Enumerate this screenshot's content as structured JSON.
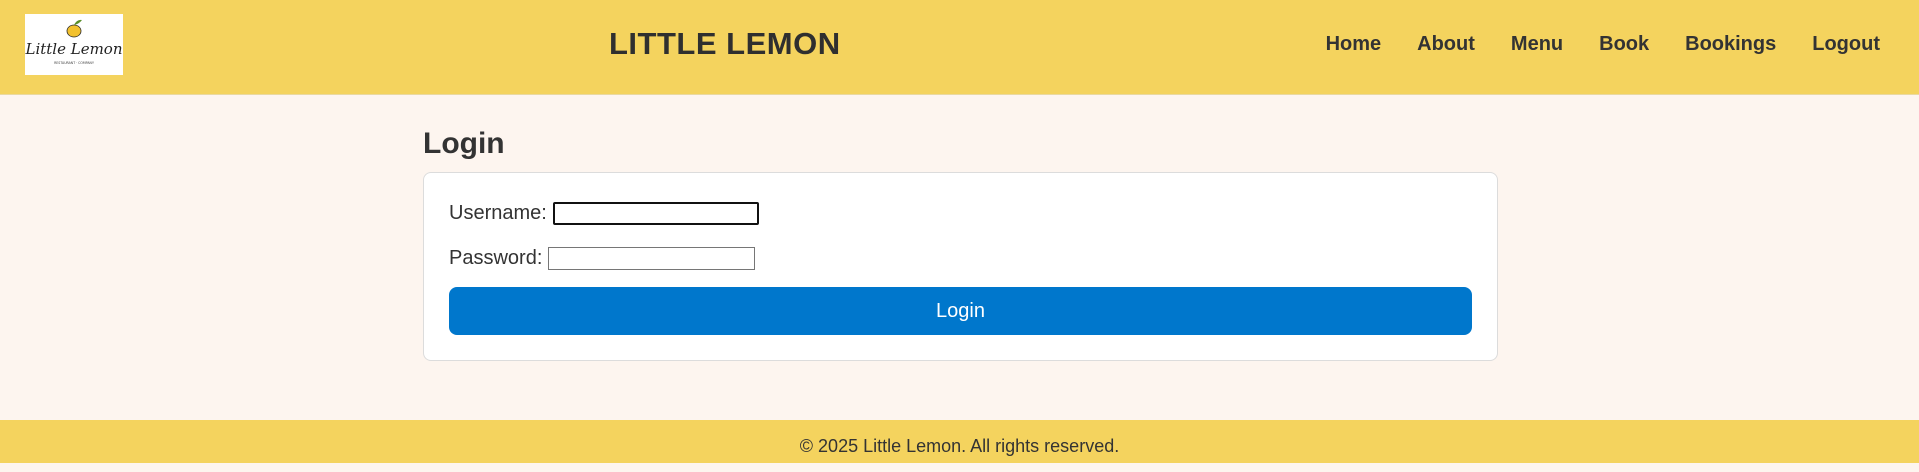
{
  "header": {
    "logo_text": "Little Lemon",
    "logo_tagline": "RESTAURANT · COMPANY",
    "title": "LITTLE LEMON",
    "nav": [
      "Home",
      "About",
      "Menu",
      "Book",
      "Bookings",
      "Logout"
    ]
  },
  "main": {
    "title": "Login",
    "form": {
      "username_label": "Username:",
      "username_value": "",
      "password_label": "Password:",
      "password_value": "",
      "submit_label": "Login"
    }
  },
  "footer": {
    "text": "© 2025 Little Lemon. All rights reserved."
  },
  "colors": {
    "header_bg": "#f4d35e",
    "page_bg": "#fdf5ef",
    "button_bg": "#0077cc"
  }
}
